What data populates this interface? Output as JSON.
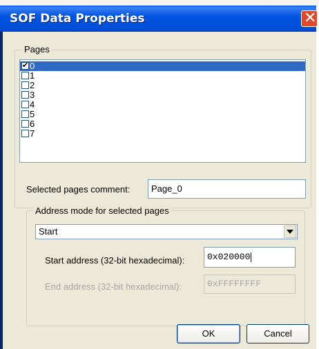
{
  "window": {
    "title": "SOF Data Properties",
    "close_glyph": "✕"
  },
  "pages": {
    "legend": "Pages",
    "items": [
      {
        "label": "0",
        "checked": true,
        "selected": true
      },
      {
        "label": "1",
        "checked": false,
        "selected": false
      },
      {
        "label": "2",
        "checked": false,
        "selected": false
      },
      {
        "label": "3",
        "checked": false,
        "selected": false
      },
      {
        "label": "4",
        "checked": false,
        "selected": false
      },
      {
        "label": "5",
        "checked": false,
        "selected": false
      },
      {
        "label": "6",
        "checked": false,
        "selected": false
      },
      {
        "label": "7",
        "checked": false,
        "selected": false
      }
    ],
    "comment_label": "Selected pages comment:",
    "comment_value": "Page_0"
  },
  "address_mode": {
    "legend": "Address mode for selected pages",
    "selected_option": "Start",
    "start_label": "Start address (32-bit hexadecimal):",
    "start_value": "0x020000",
    "end_label": "End address (32-bit hexadecimal):",
    "end_value": "0xFFFFFFFF"
  },
  "buttons": {
    "ok": "OK",
    "cancel": "Cancel"
  },
  "icons": {
    "check": "✔",
    "close": "close-icon",
    "dropdown": "chevron-down-icon"
  },
  "colors": {
    "titlebar": "#0050d8",
    "selection": "#316ac5",
    "close": "#e04a2c",
    "face": "#ece9d8"
  }
}
